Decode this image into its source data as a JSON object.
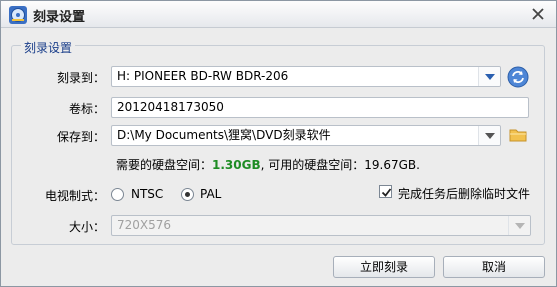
{
  "titlebar": {
    "title": "刻录设置",
    "close_icon": "close-icon",
    "app_icon": "disc-burn-icon"
  },
  "group": {
    "legend": "刻录设置"
  },
  "burn_to": {
    "label": "刻录到：",
    "value": "H: PIONEER  BD-RW   BDR-206",
    "refresh_icon": "refresh-icon"
  },
  "volume": {
    "label": "卷标：",
    "value": "20120418173050"
  },
  "save_to": {
    "label": "保存到：",
    "value": "D:\\My Documents\\狸窝\\DVD刻录软件",
    "folder_icon": "folder-icon"
  },
  "space": {
    "required_prefix": "需要的硬盘空间：",
    "required_value": "1.30GB",
    "available_text": ", 可用的硬盘空间：19.67GB."
  },
  "tv_system": {
    "label": "电视制式：",
    "options": [
      "NTSC",
      "PAL"
    ],
    "selected": "PAL"
  },
  "delete_temp": {
    "label": "完成任务后删除临时文件",
    "checked": true
  },
  "size": {
    "label": "大小：",
    "value": "720X576"
  },
  "buttons": {
    "burn_now": "立即刻录",
    "cancel": "取消"
  },
  "colors": {
    "accent_blue": "#1a3e8a",
    "space_green": "#1e8c24"
  }
}
